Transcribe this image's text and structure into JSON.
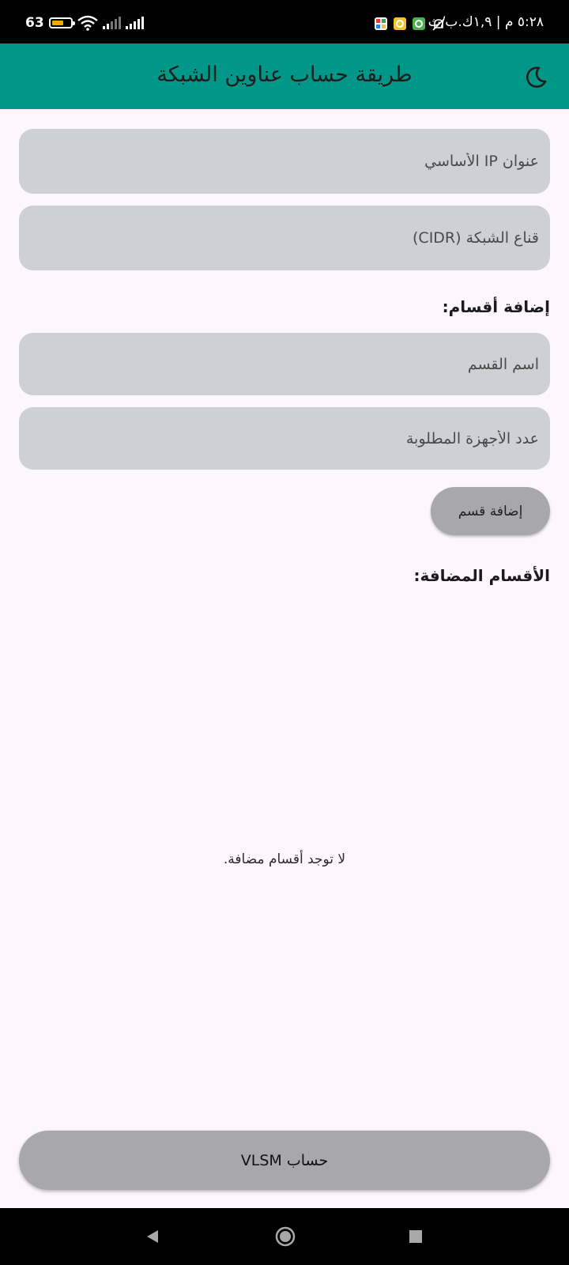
{
  "status_bar": {
    "time": "٥:٢٨ م | ١,٩ك.ب/ث",
    "battery_level": "63",
    "battery_fraction": 0.63,
    "battery_color": "#f2a900"
  },
  "app_bar": {
    "title": "طريقة حساب عناوين الشبكة",
    "background": "#009688",
    "theme_icon": "moon-icon"
  },
  "form": {
    "base_ip_placeholder": "عنوان IP الأساسي",
    "cidr_placeholder": "قناع الشبكة (CIDR)",
    "add_sections_heading": "إضافة أقسام:",
    "section_name_placeholder": "اسم القسم",
    "host_count_placeholder": "عدد الأجهزة المطلوبة",
    "add_section_button": "إضافة قسم"
  },
  "sections": {
    "heading": "الأقسام المضافة:",
    "empty_message": "لا توجد أقسام مضافة.",
    "items": []
  },
  "calculate_button": "حساب VLSM",
  "nav": {
    "back_icon": "back-triangle-icon",
    "home_icon": "home-circle-icon",
    "recents_icon": "recents-square-icon"
  }
}
